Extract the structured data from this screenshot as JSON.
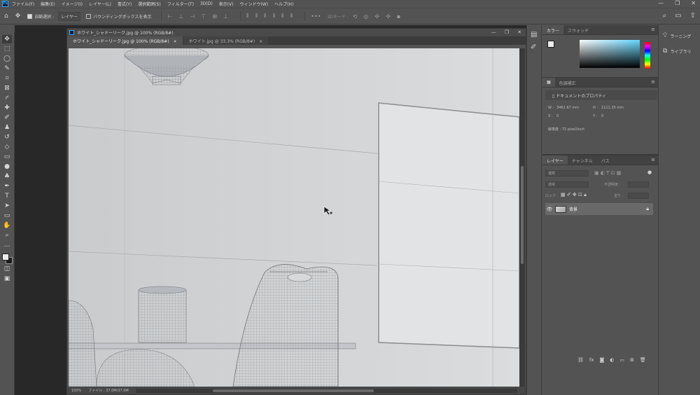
{
  "menubar": {
    "items": [
      "ファイル(F)",
      "編集(E)",
      "イメージ(I)",
      "レイヤー(L)",
      "書式(Y)",
      "選択範囲(S)",
      "フィルター(T)",
      "3D(D)",
      "表示(V)",
      "ウィンドウ(W)",
      "ヘルプ(H)"
    ],
    "window_controls": [
      "—",
      "❐",
      "✕"
    ]
  },
  "options_bar": {
    "auto_select_label": "自動選択 :",
    "layer_select": "レイヤー",
    "transform_label": "バウンディングボックスを表示",
    "mode_3d_label": "3Dモード :"
  },
  "document": {
    "title": "ホワイト_シャドーリーク.jpg @ 100% (RGB/8#)",
    "tabs": [
      {
        "label": "ホワイト_シャドーリーク.jpg @ 100% (RGB/8#)",
        "close": "×"
      },
      {
        "label": "ホワイト.jpg @ 33.3% (RGB/8#)",
        "close": "×"
      }
    ],
    "zoom": "100%",
    "file_info": "ファイル : 37.0M/37.0M"
  },
  "color_panel": {
    "tabs": [
      "カラー",
      "スウォッチ"
    ],
    "fg_color": "#eeeeee",
    "bg_color": "#1d1d1d"
  },
  "properties_panel": {
    "tabs": [
      "",
      "色調補正"
    ],
    "header": "ドキュメントのプロパティ",
    "w_label": "W :",
    "w_value": "3461.67 mm",
    "h_label": "H :",
    "h_value": "1111.25 mm",
    "x_label": "X :",
    "x_value": "0",
    "y_label": "Y :",
    "y_value": "0",
    "resolution": "解像度 : 72 pixel/inch"
  },
  "layers_panel": {
    "tabs": [
      "レイヤー",
      "チャンネル",
      "パス"
    ],
    "filter_kind": "種類",
    "blend_mode": "通常",
    "opacity_label": "不透明度 :",
    "lock_label": "ロック :",
    "fill_label": "塗り :",
    "layer_name": "背景"
  },
  "far_right": {
    "learn": "ラーニング",
    "libraries": "ライブラリ"
  }
}
